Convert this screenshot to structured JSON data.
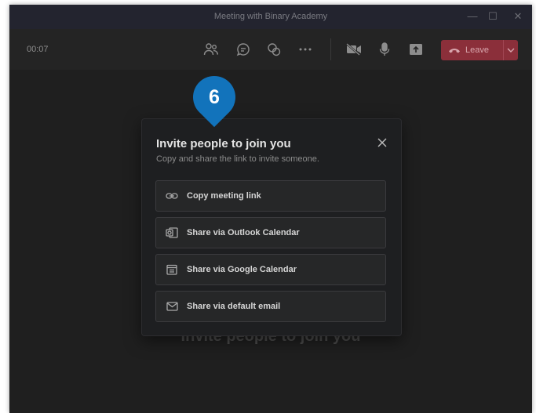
{
  "window": {
    "title": "Meeting with Binary Academy",
    "controls": {
      "minimize": "—",
      "maximize": "☐",
      "close": "✕"
    }
  },
  "toolbar": {
    "timer": "00:07",
    "icons": [
      "people-icon",
      "chat-icon",
      "reactions-icon",
      "more-icon",
      "camera-off-icon",
      "microphone-icon",
      "share-screen-icon"
    ],
    "leave_label": "Leave"
  },
  "step_marker": {
    "number": "6",
    "color": "#1273bb"
  },
  "background_heading": "Invite people to join you",
  "dialog": {
    "title": "Invite people to join you",
    "subtitle": "Copy and share the link to invite someone.",
    "options": [
      {
        "label": "Copy meeting link",
        "icon": "link-icon"
      },
      {
        "label": "Share via Outlook Calendar",
        "icon": "outlook-icon"
      },
      {
        "label": "Share via Google Calendar",
        "icon": "calendar-icon"
      },
      {
        "label": "Share via default email",
        "icon": "mail-icon"
      }
    ]
  },
  "colors": {
    "background": "#1f1f1f",
    "leave_button": "#8b2f3a",
    "accent": "#1273bb"
  }
}
